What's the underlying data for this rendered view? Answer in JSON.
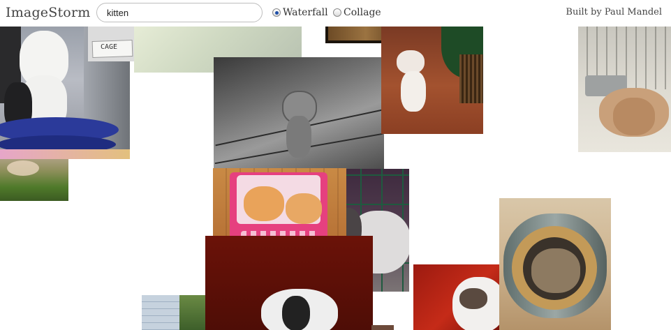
{
  "app": {
    "title": "ImageStorm"
  },
  "search": {
    "value": "kitten"
  },
  "modes": [
    {
      "label": "Waterfall",
      "selected": true
    },
    {
      "label": "Collage",
      "selected": false
    }
  ],
  "credit": {
    "prefix": "Built by",
    "author": "Paul Mandel"
  },
  "images": {
    "kitten_cage": {
      "sign": "CAGE"
    }
  }
}
